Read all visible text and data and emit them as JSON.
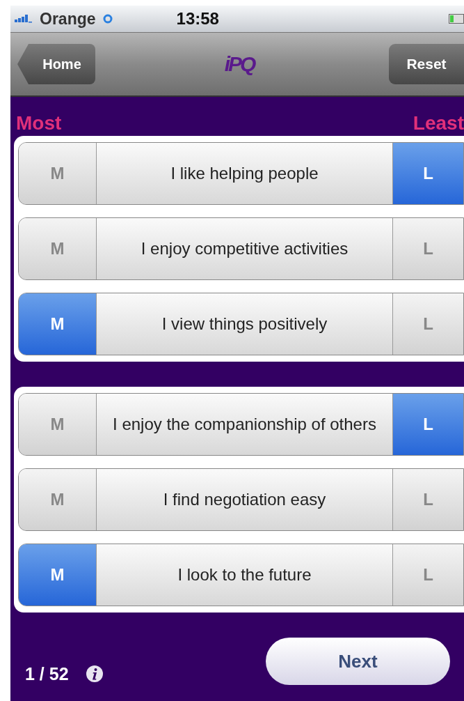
{
  "status_bar": {
    "carrier": "Orange",
    "time": "13:58"
  },
  "nav_bar": {
    "back": "Home",
    "logo": "iPQ",
    "action": "Reset"
  },
  "headers": {
    "most": "Most",
    "least": "Least"
  },
  "groups": [
    {
      "items": [
        {
          "most_label": "M",
          "text": "I like helping people",
          "least_label": "L",
          "most": false,
          "least": true
        },
        {
          "most_label": "M",
          "text": "I enjoy competitive activities",
          "least_label": "L",
          "most": false,
          "least": false
        },
        {
          "most_label": "M",
          "text": "I view things positively",
          "least_label": "L",
          "most": true,
          "least": false
        }
      ]
    },
    {
      "items": [
        {
          "most_label": "M",
          "text": "I enjoy the companionship of others",
          "least_label": "L",
          "most": false,
          "least": true
        },
        {
          "most_label": "M",
          "text": "I find negotiation easy",
          "least_label": "L",
          "most": false,
          "least": false
        },
        {
          "most_label": "M",
          "text": "I look to the future",
          "least_label": "L",
          "most": true,
          "least": false
        }
      ]
    }
  ],
  "footer": {
    "progress": "1 / 52",
    "next": "Next"
  }
}
